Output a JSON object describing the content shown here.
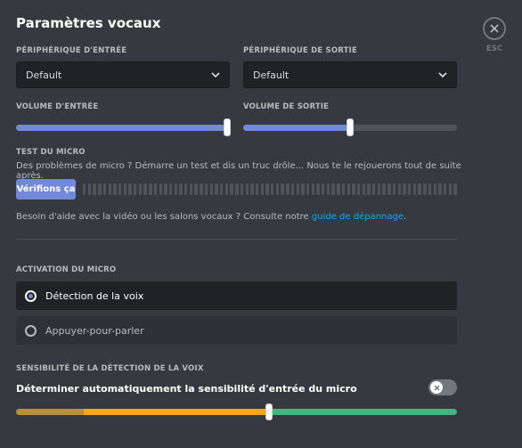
{
  "title": "Paramètres vocaux",
  "close": {
    "label": "ESC",
    "icon": "close-icon"
  },
  "input_device": {
    "label": "Périphérique d'entrée",
    "value": "Default"
  },
  "output_device": {
    "label": "Périphérique de sortie",
    "value": "Default"
  },
  "input_volume": {
    "label": "Volume d'entrée",
    "level": 1.0
  },
  "output_volume": {
    "label": "Volume de sortie",
    "level": 0.5
  },
  "mic_test": {
    "label": "Test du micro",
    "description": "Des problèmes de micro ? Démarre un test et dis un truc drôle... Nous te le rejouerons tout de suite après.",
    "button_label": "Vérifions ça"
  },
  "help": {
    "text": "Besoin d'aide avec la vidéo ou les salons vocaux ? Consulte notre ",
    "link": "guide de dépannage",
    "suffix": "."
  },
  "activation": {
    "label": "Activation du micro",
    "options": [
      {
        "label": "Détection de la voix",
        "selected": true
      },
      {
        "label": "Appuyer-pour-parler",
        "selected": false
      }
    ]
  },
  "sensitivity": {
    "label": "Sensibilité de la détection de la voix",
    "auto_label": "Déterminer automatiquement la sensibilité d'entrée du micro",
    "auto_enabled": false,
    "threshold": 0.57
  },
  "colors": {
    "accent": "#7289da",
    "link": "#00b0f4",
    "sens_low": "#b88f3b",
    "sens_mid": "#faa61a",
    "sens_high": "#43b581"
  }
}
